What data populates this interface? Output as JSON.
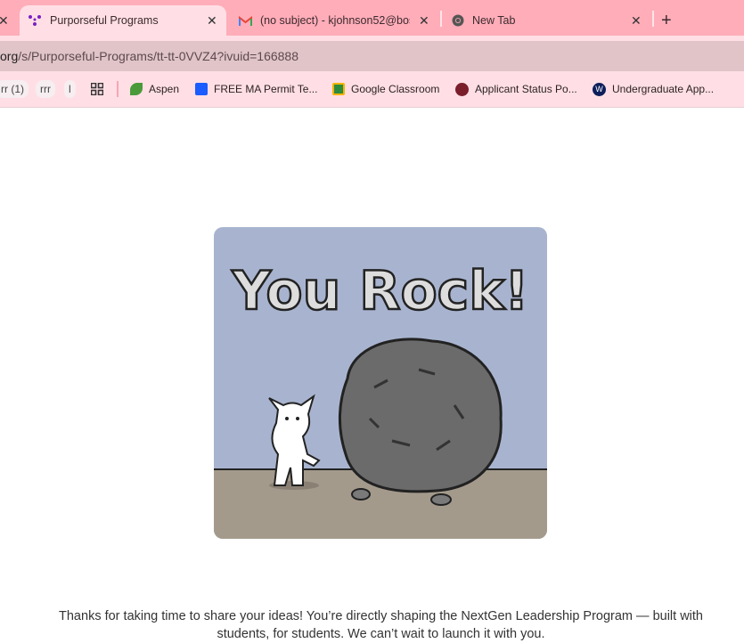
{
  "tabs": [
    {
      "title": "Purporseful Programs",
      "icon": "purpose-logo-icon",
      "active": true
    },
    {
      "title": "(no subject) - kjohnson52@bos",
      "icon": "gmail-icon"
    },
    {
      "title": "New Tab",
      "icon": "chrome-icon"
    }
  ],
  "new_tab_label": "+",
  "close_label": "✕",
  "url": {
    "domain": "org",
    "path": "/s/Purporseful-Programs/tt-tt-0VVZ4?ivuid=166888"
  },
  "bookmarks": [
    {
      "label": "rr (1)"
    },
    {
      "label": "rrr"
    },
    {
      "label": "l"
    },
    {
      "label": "Aspen",
      "icon": "leaf-icon"
    },
    {
      "label": "FREE MA Permit Te...",
      "icon": "shield-icon"
    },
    {
      "label": "Google Classroom",
      "icon": "classroom-icon"
    },
    {
      "label": "Applicant Status Po...",
      "icon": "dog-logo-icon"
    },
    {
      "label": "Undergraduate App...",
      "icon": "w-logo-icon"
    }
  ],
  "hero": {
    "caption": "You Rock!",
    "colors": {
      "sky": "#a8b4cf",
      "ground": "#a49a8c",
      "rock": "#6b6b6b"
    }
  },
  "message": {
    "line1": "Thanks for taking  time to share your ideas! You’re directly shaping the NextGen Leadership Program — built with",
    "line2": "students, for students. We can’t wait to launch it with you."
  }
}
